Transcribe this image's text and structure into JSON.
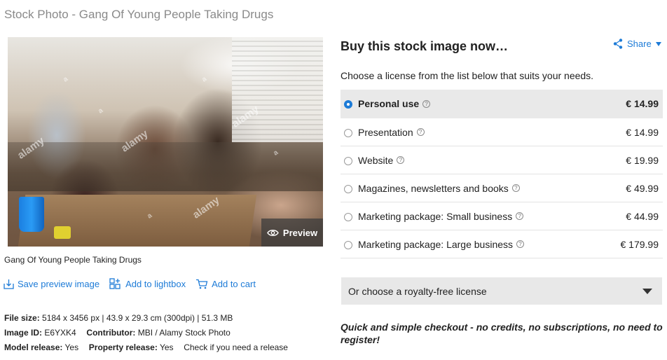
{
  "page": {
    "title": "Stock Photo - Gang Of Young People Taking Drugs"
  },
  "image": {
    "watermark": "alamy",
    "watermark_small": "a",
    "preview_label": "Preview",
    "caption": "Gang Of Young People Taking Drugs"
  },
  "actions": [
    {
      "label": "Save preview image",
      "icon": "download-icon"
    },
    {
      "label": "Add to lightbox",
      "icon": "lightbox-icon"
    },
    {
      "label": "Add to cart",
      "icon": "cart-icon"
    }
  ],
  "meta": {
    "file_size_label": "File size:",
    "file_size_value": "5184 x 3456 px | 43.9 x 29.3 cm (300dpi) | 51.3 MB",
    "image_id_label": "Image ID:",
    "image_id_value": "E6YXK4",
    "contributor_label": "Contributor:",
    "contributor_value": "MBI / Alamy Stock Photo",
    "model_release_label": "Model release:",
    "model_release_value": "Yes",
    "property_release_label": "Property release:",
    "property_release_value": "Yes",
    "release_note": "Check if you need a release"
  },
  "buy": {
    "title": "Buy this stock image now…",
    "share_label": "Share",
    "choose_text": "Choose a license from the list below that suits your needs.",
    "help_glyph": "?",
    "licenses": [
      {
        "name": "Personal use",
        "price": "€ 14.99",
        "selected": true
      },
      {
        "name": "Presentation",
        "price": "€ 14.99",
        "selected": false
      },
      {
        "name": "Website",
        "price": "€ 19.99",
        "selected": false
      },
      {
        "name": "Magazines, newsletters and books",
        "price": "€ 49.99",
        "selected": false
      },
      {
        "name": "Marketing package: Small business",
        "price": "€ 44.99",
        "selected": false
      },
      {
        "name": "Marketing package: Large business",
        "price": "€ 179.99",
        "selected": false
      }
    ],
    "royalty_label": "Or choose a royalty-free license",
    "checkout_text": "Quick and simple checkout - no credits, no subscriptions, no need to register!"
  },
  "colors": {
    "accent": "#1d7bd7",
    "selected_row": "#e9e9e9",
    "title_gray": "#8a8a8a"
  }
}
